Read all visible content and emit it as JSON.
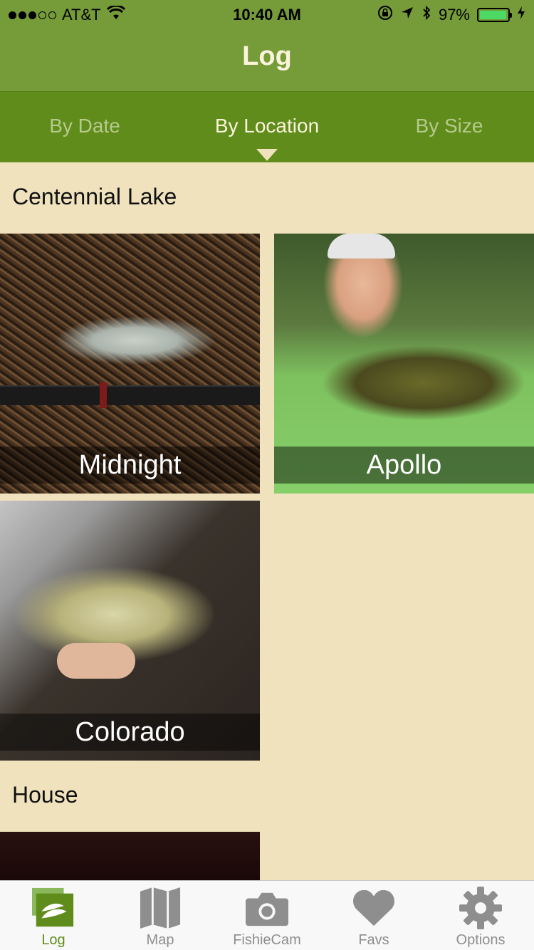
{
  "status_bar": {
    "carrier": "AT&T",
    "time": "10:40 AM",
    "battery": "97%",
    "battery_level": 0.97
  },
  "nav": {
    "title": "Log"
  },
  "segments": {
    "items": [
      "By Date",
      "By Location",
      "By Size"
    ],
    "active_index": 1
  },
  "sections": [
    {
      "title": "Centennial Lake",
      "photos": [
        "Midnight",
        "Apollo",
        "Colorado"
      ]
    },
    {
      "title": "House"
    }
  ],
  "tabbar": {
    "items": [
      {
        "label": "Log",
        "icon": "log-icon"
      },
      {
        "label": "Map",
        "icon": "map-icon"
      },
      {
        "label": "FishieCam",
        "icon": "camera-icon"
      },
      {
        "label": "Favs",
        "icon": "heart-icon"
      },
      {
        "label": "Options",
        "icon": "gear-icon"
      }
    ],
    "active_index": 0
  },
  "colors": {
    "nav_green": "#769b39",
    "segment_green": "#5f8c1a",
    "content_bg": "#f0e2bd",
    "tab_inactive": "#8e8e8e"
  }
}
